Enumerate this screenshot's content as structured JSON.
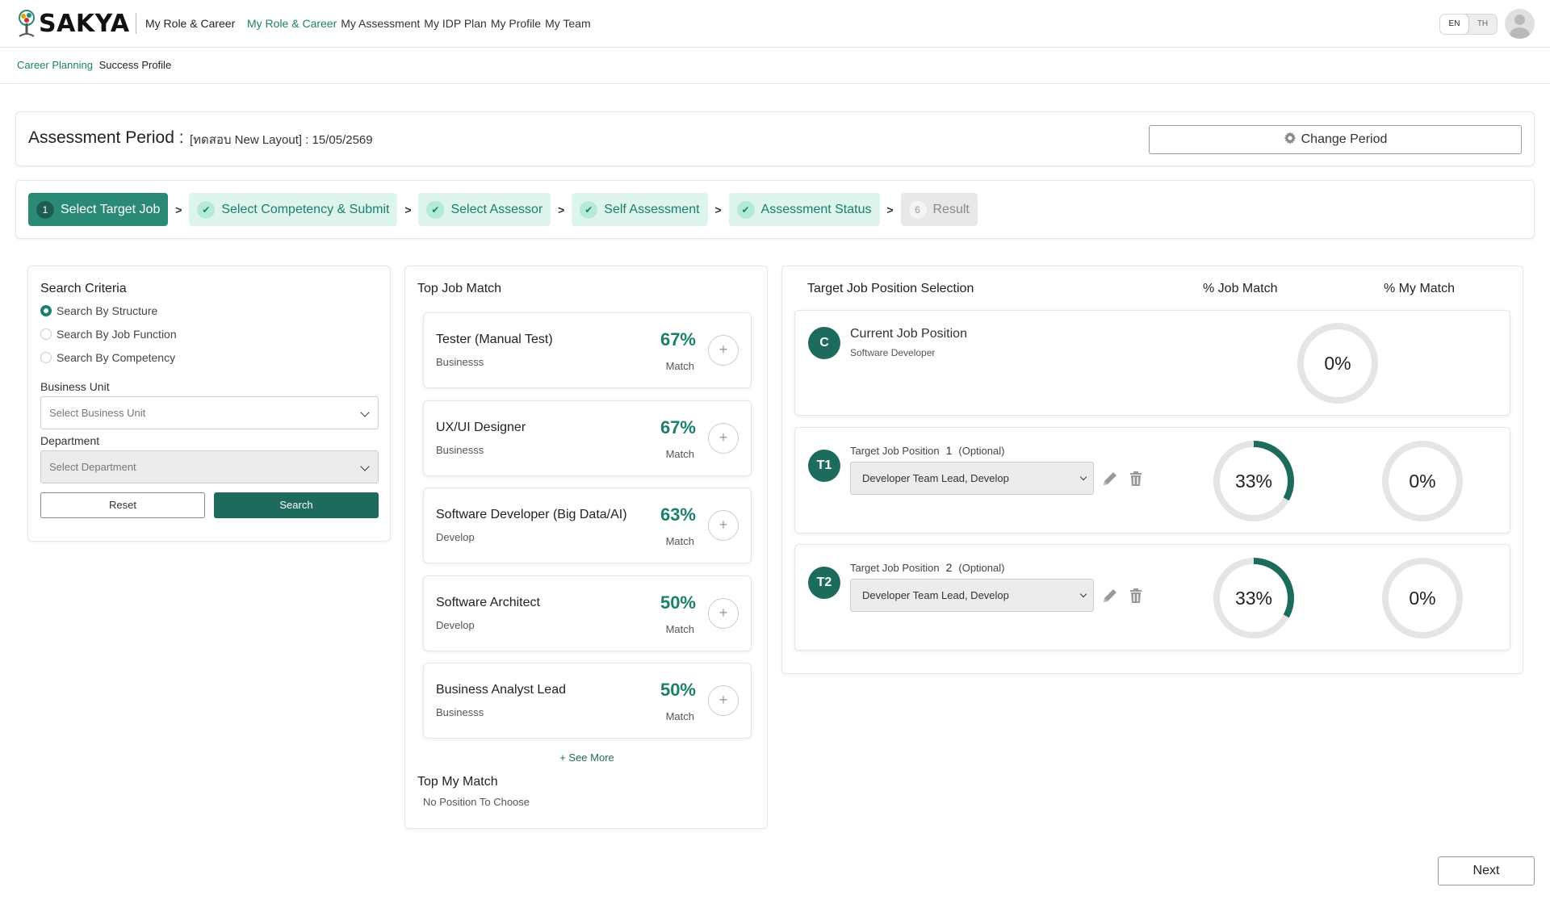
{
  "header": {
    "brand": "SAKYA",
    "app_name": "My Role & Career",
    "nav": [
      {
        "label": "My Role & Career",
        "active": true
      },
      {
        "label": "My Assessment",
        "active": false
      },
      {
        "label": "My IDP Plan",
        "active": false
      },
      {
        "label": "My Profile",
        "active": false
      },
      {
        "label": "My Team",
        "active": false
      }
    ],
    "lang": {
      "en": "EN",
      "th": "TH",
      "selected": "EN"
    },
    "avatar_icon": "user-avatar-icon"
  },
  "subnav": [
    {
      "label": "Career Planning",
      "active": true
    },
    {
      "label": "Success Profile",
      "active": false
    }
  ],
  "period": {
    "title": "Assessment Period :",
    "value": "[ทดสอบ New Layout] : 15/05/2569",
    "change_button": "Change Period",
    "change_icon": "gear-icon"
  },
  "stepper": {
    "steps": [
      {
        "number": "1",
        "label": "Select Target Job",
        "state": "current"
      },
      {
        "number": "2",
        "label": "Select Competency & Submit",
        "state": "done"
      },
      {
        "number": "3",
        "label": "Select Assessor",
        "state": "done"
      },
      {
        "number": "4",
        "label": "Self Assessment",
        "state": "done"
      },
      {
        "number": "5",
        "label": "Assessment Status",
        "state": "done"
      },
      {
        "number": "6",
        "label": "Result",
        "state": "pending"
      }
    ]
  },
  "search": {
    "title": "Search Criteria",
    "options": [
      {
        "label": "Search By Structure",
        "checked": true
      },
      {
        "label": "Search By Job Function",
        "checked": false
      },
      {
        "label": "Search By Competency",
        "checked": false
      }
    ],
    "business_unit_label": "Business Unit",
    "business_unit_placeholder": "Select Business Unit",
    "department_label": "Department",
    "department_placeholder": "Select Department",
    "reset_label": "Reset",
    "search_label": "Search"
  },
  "top_job_match": {
    "title": "Top Job Match",
    "match_label": "Match",
    "jobs": [
      {
        "name": "Tester (Manual Test)",
        "category": "Businesss",
        "percent": "67%"
      },
      {
        "name": "UX/UI Designer",
        "category": "Businesss",
        "percent": "67%"
      },
      {
        "name": "Software Developer (Big Data/AI)",
        "category": "Develop",
        "percent": "63%"
      },
      {
        "name": "Software Architect",
        "category": "Develop",
        "percent": "50%"
      },
      {
        "name": "Business Analyst Lead",
        "category": "Businesss",
        "percent": "50%"
      }
    ],
    "see_more": "+ See More",
    "my_match_title": "Top My Match",
    "my_match_empty": "No Position To Choose"
  },
  "target": {
    "title": "Target Job Position Selection",
    "col_job_match": "% Job Match",
    "col_my_match": "% My Match",
    "current": {
      "badge": "C",
      "title": "Current Job Position",
      "subtitle": "Software Developer",
      "job_match": "0%",
      "job_match_value": 0
    },
    "targets": [
      {
        "badge": "T1",
        "label": "Target Job Position",
        "number": "1",
        "optional": "(Optional)",
        "selected": "Developer Team Lead, Develop",
        "job_match": "33%",
        "job_match_value": 33,
        "my_match": "0%",
        "my_match_value": 0
      },
      {
        "badge": "T2",
        "label": "Target Job Position",
        "number": "2",
        "optional": "(Optional)",
        "selected": "Developer Team Lead, Develop",
        "job_match": "33%",
        "job_match_value": 33,
        "my_match": "0%",
        "my_match_value": 0
      }
    ]
  },
  "next_label": "Next",
  "colors": {
    "primary": "#1d6b5c",
    "accent": "#1a7f6b",
    "step_done_bg": "#ddf5ec",
    "ring_bg": "#e6e4e8"
  }
}
